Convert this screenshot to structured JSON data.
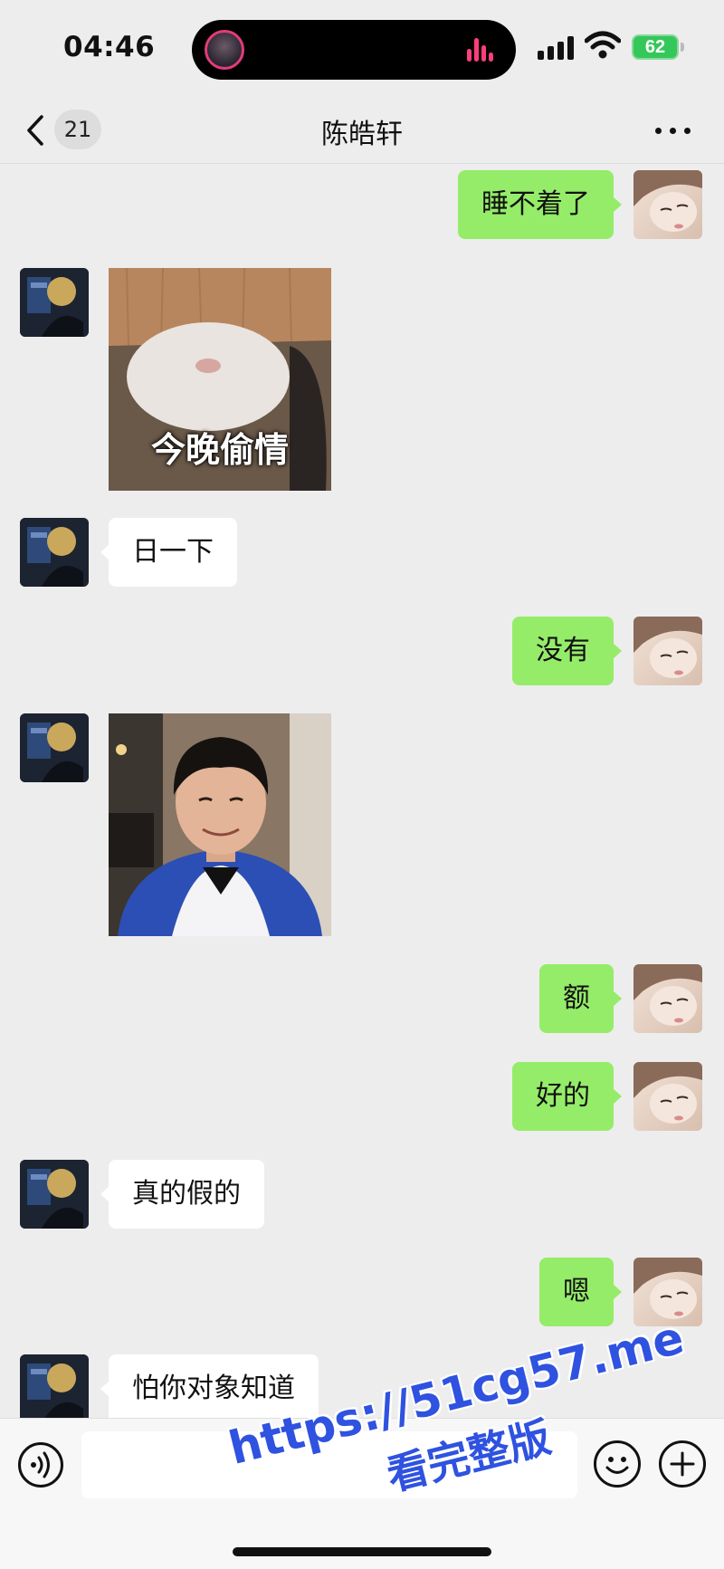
{
  "status_bar": {
    "time": "04:46",
    "battery": "62",
    "icons": [
      "music-avatar-icon",
      "audio-bars-icon",
      "signal-icon",
      "wifi-icon",
      "battery-icon"
    ]
  },
  "nav": {
    "back_icon": "chevron-left-icon",
    "unread_count": "21",
    "title": "陈皓轩",
    "more_icon": "ellipsis-icon"
  },
  "messages": [
    {
      "sender": "self",
      "type": "text",
      "text": "睡不着了"
    },
    {
      "sender": "other",
      "type": "sticker",
      "caption": "今晚偷情"
    },
    {
      "sender": "other",
      "type": "text",
      "text": "日一下"
    },
    {
      "sender": "self",
      "type": "text",
      "text": "没有"
    },
    {
      "sender": "other",
      "type": "sticker",
      "caption": ""
    },
    {
      "sender": "self",
      "type": "text",
      "text": "额"
    },
    {
      "sender": "self",
      "type": "text",
      "text": "好的"
    },
    {
      "sender": "other",
      "type": "text",
      "text": "真的假的"
    },
    {
      "sender": "self",
      "type": "text",
      "text": "嗯"
    },
    {
      "sender": "other",
      "type": "text",
      "text": "怕你对象知道"
    }
  ],
  "input_bar": {
    "input_value": "",
    "icons": [
      "voice-icon",
      "emoji-icon",
      "plus-icon"
    ]
  },
  "watermark": {
    "url": "https://51cg57.me",
    "subtitle": "看完整版"
  },
  "colors": {
    "background": "#ededed",
    "self_bubble": "#95ec69",
    "other_bubble": "#ffffff",
    "watermark": "#2f52e0",
    "battery": "#34c759"
  }
}
